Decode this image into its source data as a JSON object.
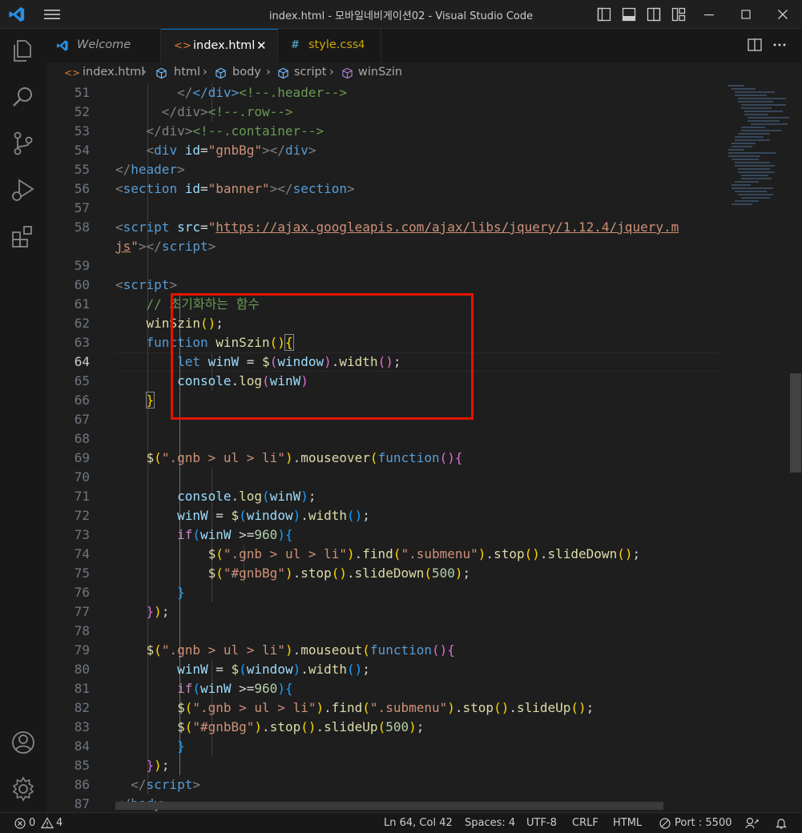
{
  "window": {
    "title": "index.html - 모바일네비게이션02 - Visual Studio Code"
  },
  "tabs": [
    {
      "label": "Welcome",
      "icon": "vscode-icon"
    },
    {
      "label": "index.html",
      "icon": "html-icon",
      "close": "✕"
    },
    {
      "label": "style.css",
      "icon": "css-hash-icon",
      "badge": "4"
    }
  ],
  "breadcrumb": [
    "index.html",
    "html",
    "body",
    "script",
    "winSzin"
  ],
  "editor": {
    "current_line": 64,
    "line_numbers": [
      "51",
      "52",
      "53",
      "54",
      "55",
      "56",
      "57",
      "58",
      "",
      "59",
      "60",
      "61",
      "62",
      "63",
      "64",
      "65",
      "66",
      "67",
      "68",
      "69",
      "70",
      "71",
      "72",
      "73",
      "74",
      "75",
      "76",
      "77",
      "78",
      "79",
      "80",
      "81",
      "82",
      "83",
      "84",
      "85",
      "86",
      "87"
    ],
    "lines": {
      "l51a": "</div>",
      "l51b": "<!--.header-->",
      "l52a": "</div>",
      "l52b": "<!--.row-->",
      "l53a": "</div>",
      "l53b": "<!--.container-->",
      "l54_tag": "div",
      "l54_attr": "id",
      "l54_val": "\"gnbBg\"",
      "l55": "header",
      "l56_tag": "section",
      "l56_attr": "id",
      "l56_val": "\"banner\"",
      "l56_close": "section",
      "l58_tag": "script",
      "l58_attr": "src",
      "l58_url": "https://ajax.googleapis.com/ajax/libs/jquery/1.12.4/jquery.m",
      "l58_cont": "js",
      "l58_close": "script",
      "l60": "script",
      "l61": "// 초기화하는 함수",
      "l62_fn": "winSzin",
      "l63_kw": "function",
      "l63_fn": "winSzin",
      "l64_kw": "let",
      "l64_var": "winW",
      "l64_win": "window",
      "l64_fn": "width",
      "l65_obj": "console",
      "l65_fn": "log",
      "l65_var": "winW",
      "l69_str": "\".gnb > ul > li\"",
      "l69_fn": "mouseover",
      "l69_kw": "function",
      "l71_obj": "console",
      "l71_fn": "log",
      "l71_var": "winW",
      "l72_var": "winW",
      "l72_win": "window",
      "l72_fn": "width",
      "l73_kw": "if",
      "l73_var": "winW",
      "l73_num": "960",
      "l74_str1": "\".gnb > ul > li\"",
      "l74_fn1": "find",
      "l74_str2": "\".submenu\"",
      "l74_fn2": "stop",
      "l74_fn3": "slideDown",
      "l75_str": "\"#gnbBg\"",
      "l75_fn1": "stop",
      "l75_fn2": "slideDown",
      "l75_num": "500",
      "l79_str": "\".gnb > ul > li\"",
      "l79_fn": "mouseout",
      "l79_kw": "function",
      "l80_var": "winW",
      "l80_win": "window",
      "l80_fn": "width",
      "l81_kw": "if",
      "l81_var": "winW",
      "l81_num": "960",
      "l82_str1": "\".gnb > ul > li\"",
      "l82_fn1": "find",
      "l82_str2": "\".submenu\"",
      "l82_fn2": "stop",
      "l82_fn3": "slideUp",
      "l83_str": "\"#gnbBg\"",
      "l83_fn1": "stop",
      "l83_fn2": "slideUp",
      "l83_num": "500",
      "l86": "script",
      "l87": "body"
    }
  },
  "statusbar": {
    "errors": "0",
    "warnings": "4",
    "position": "Ln 64, Col 42",
    "spaces": "Spaces: 4",
    "encoding": "UTF-8",
    "eol": "CRLF",
    "language": "HTML",
    "port": "Port : 5500"
  },
  "colors": {
    "accent": "#0078d4",
    "highlight_box": "#e51400"
  }
}
